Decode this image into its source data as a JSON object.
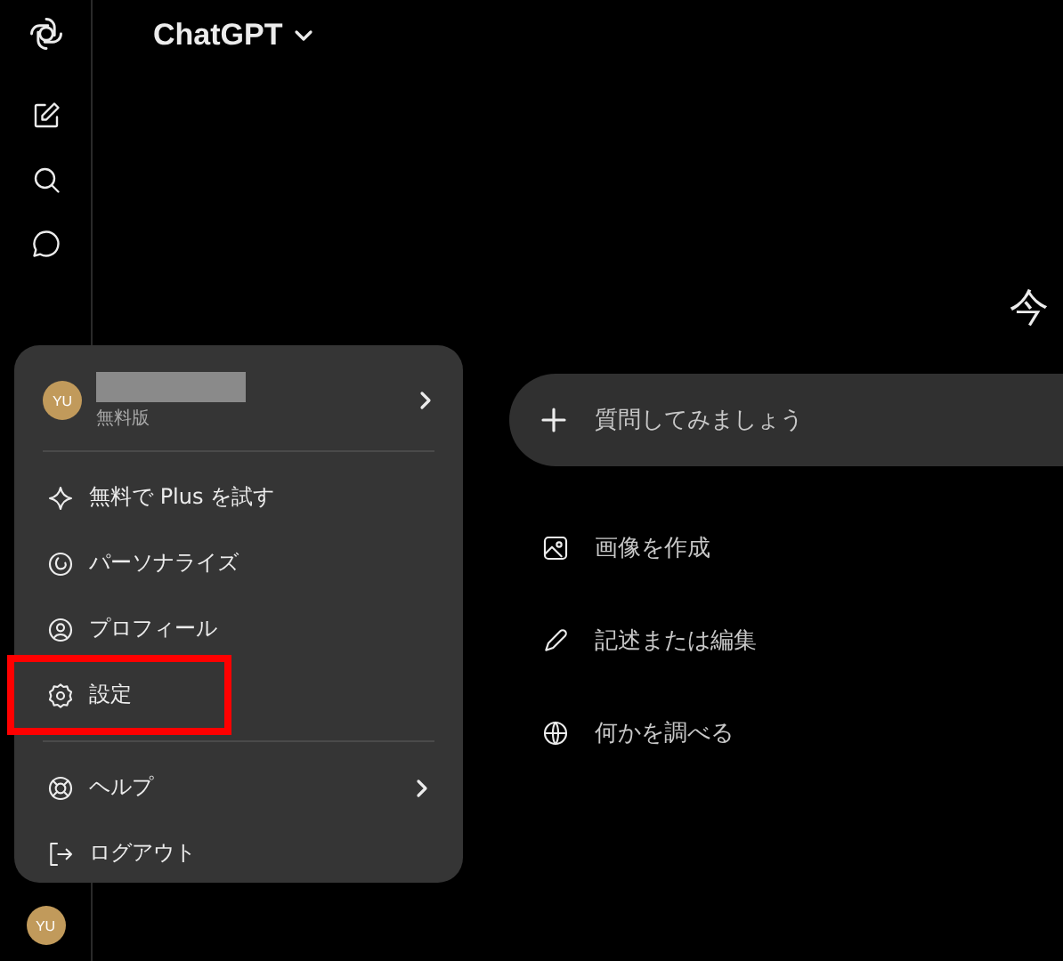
{
  "header": {
    "title": "ChatGPT"
  },
  "sidebar": {
    "avatar": "YU"
  },
  "heading": "今",
  "composer": {
    "placeholder": "質問してみましょう"
  },
  "suggestions": [
    {
      "kind": "image",
      "label": "画像を作成"
    },
    {
      "kind": "pencil",
      "label": "記述または編集"
    },
    {
      "kind": "globe",
      "label": "何かを調べる"
    }
  ],
  "account_menu": {
    "avatar": "YU",
    "plan": "無料版",
    "items": [
      {
        "kind": "sparkle",
        "label": "無料で Plus を試す",
        "submenu": false,
        "divider_before": false,
        "highlighted": false
      },
      {
        "kind": "personalize",
        "label": "パーソナライズ",
        "submenu": false,
        "divider_before": false,
        "highlighted": false
      },
      {
        "kind": "profile",
        "label": "プロフィール",
        "submenu": false,
        "divider_before": false,
        "highlighted": false
      },
      {
        "kind": "settings",
        "label": "設定",
        "submenu": false,
        "divider_before": false,
        "highlighted": true
      },
      {
        "kind": "help",
        "label": "ヘルプ",
        "submenu": true,
        "divider_before": true,
        "highlighted": false
      },
      {
        "kind": "logout",
        "label": "ログアウト",
        "submenu": false,
        "divider_before": false,
        "highlighted": false
      }
    ]
  }
}
